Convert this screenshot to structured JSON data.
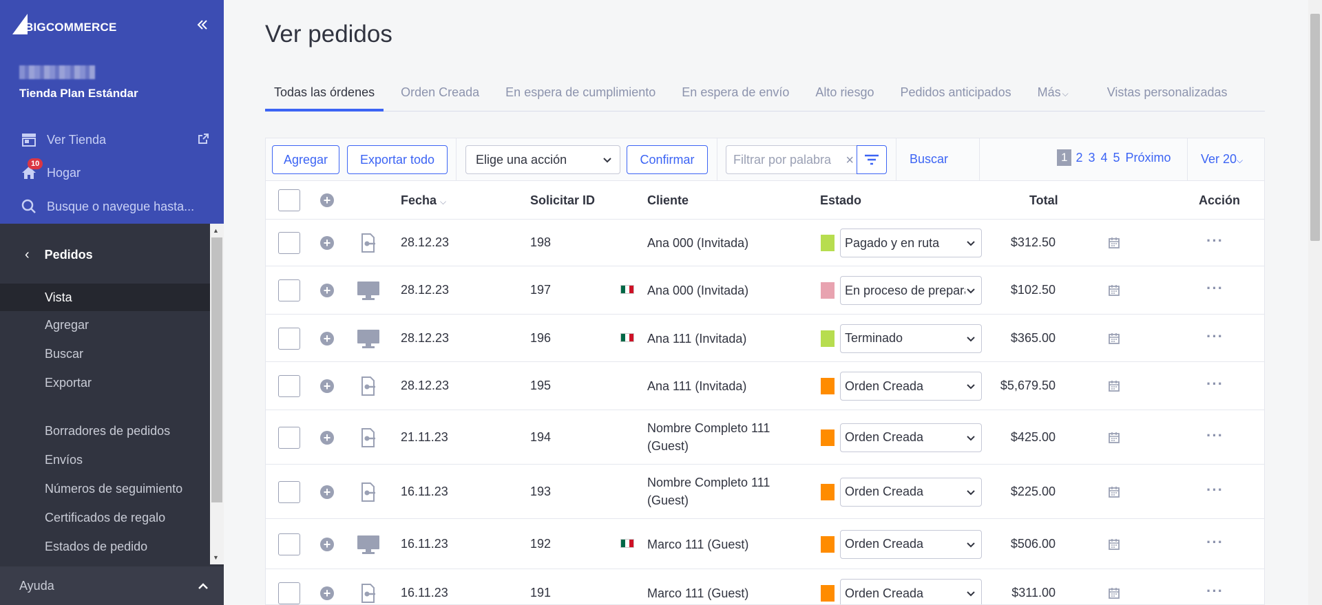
{
  "sidebar": {
    "logo_text": "BIGCOMMERCE",
    "store_name": "Tienda Plan Estándar",
    "view_store": "Ver Tienda",
    "home": "Hogar",
    "home_badge": "10",
    "search": "Busque o navegue hasta...",
    "section": "Pedidos",
    "items": [
      "Vista",
      "Agregar",
      "Buscar",
      "Exportar",
      "Borradores de pedidos",
      "Envíos",
      "Números de seguimiento",
      "Certificados de regalo",
      "Estados de pedido"
    ],
    "help": "Ayuda"
  },
  "page": {
    "title": "Ver pedidos",
    "tabs": [
      "Todas las órdenes",
      "Orden Creada",
      "En espera de cumplimiento",
      "En espera de envío",
      "Alto riesgo",
      "Pedidos anticipados",
      "Más",
      "Vistas personalizadas"
    ]
  },
  "toolbar": {
    "add": "Agregar",
    "export_all": "Exportar todo",
    "action_select": "Elige una acción",
    "confirm": "Confirmar",
    "filter_placeholder": "Filtrar por palabra",
    "search": "Buscar",
    "pages": [
      "1",
      "2",
      "3",
      "4",
      "5"
    ],
    "next": "Próximo",
    "view": "Ver 20"
  },
  "table": {
    "headers": {
      "date": "Fecha",
      "order_id": "Solicitar ID",
      "customer": "Cliente",
      "status": "Estado",
      "total": "Total",
      "action": "Acción"
    },
    "rows": [
      {
        "date": "28.12.23",
        "id": "198",
        "customer": "Ana 000 (Invitada)",
        "status": "Pagado y en ruta",
        "color": "#b7dd4f",
        "total": "$312.50",
        "source": "phone",
        "flag": false
      },
      {
        "date": "28.12.23",
        "id": "197",
        "customer": "Ana 000 (Invitada)",
        "status": "En proceso de preparación",
        "color": "#e8a3b0",
        "total": "$102.50",
        "source": "desktop",
        "flag": true
      },
      {
        "date": "28.12.23",
        "id": "196",
        "customer": "Ana 111 (Invitada)",
        "status": "Terminado",
        "color": "#b7dd4f",
        "total": "$365.00",
        "source": "desktop",
        "flag": true
      },
      {
        "date": "28.12.23",
        "id": "195",
        "customer": "Ana 111 (Invitada)",
        "status": "Orden Creada",
        "color": "#ff8c00",
        "total": "$5,679.50",
        "source": "phone",
        "flag": false
      },
      {
        "date": "21.11.23",
        "id": "194",
        "customer_l1": "Nombre Completo 111",
        "customer_l2": "(Guest)",
        "status": "Orden Creada",
        "color": "#ff8c00",
        "total": "$425.00",
        "source": "phone",
        "flag": false
      },
      {
        "date": "16.11.23",
        "id": "193",
        "customer_l1": "Nombre Completo 111",
        "customer_l2": "(Guest)",
        "status": "Orden Creada",
        "color": "#ff8c00",
        "total": "$225.00",
        "source": "phone",
        "flag": false
      },
      {
        "date": "16.11.23",
        "id": "192",
        "customer": "Marco 111 (Guest)",
        "status": "Orden Creada",
        "color": "#ff8c00",
        "total": "$506.00",
        "source": "desktop",
        "flag": true
      },
      {
        "date": "16.11.23",
        "id": "191",
        "customer": "Marco 111 (Guest)",
        "status": "Orden Creada",
        "color": "#ff8c00",
        "total": "$311.00",
        "source": "phone",
        "flag": false
      }
    ]
  }
}
